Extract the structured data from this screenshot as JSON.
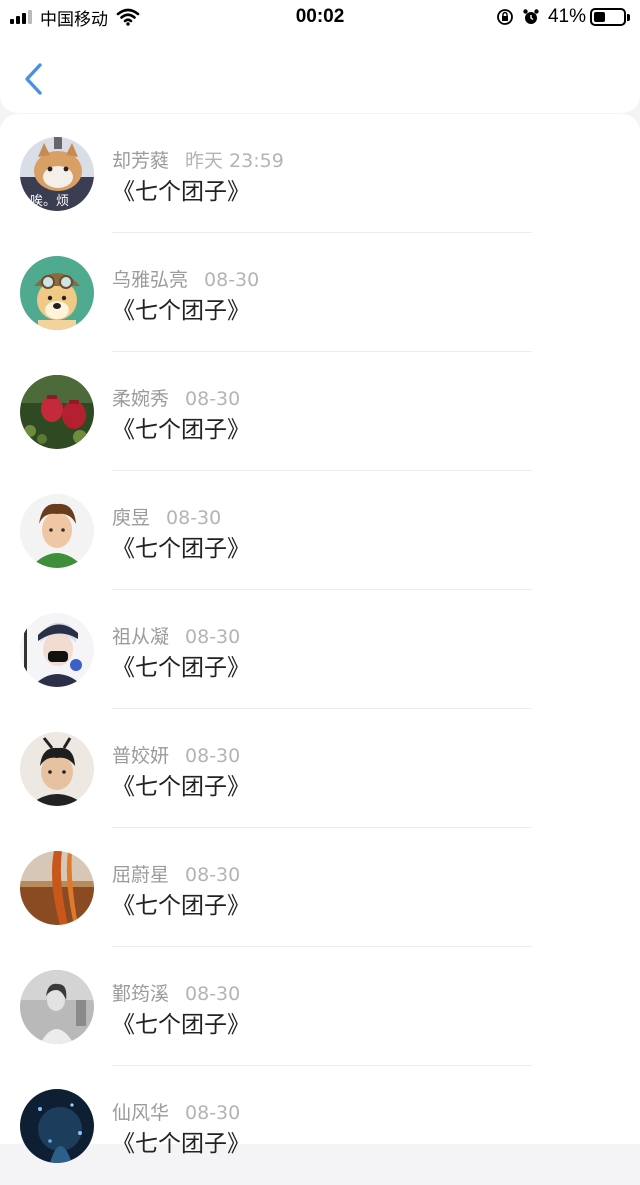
{
  "status_bar": {
    "carrier": "中国移动",
    "time": "00:02",
    "battery": "41%",
    "battery_level": 0.41
  },
  "header": {
    "back_icon": "chevron-left-icon"
  },
  "items": [
    {
      "name": "却芳蕤",
      "time": "昨天 23:59",
      "title": "《七个团子》",
      "avatar": "cat-avatar"
    },
    {
      "name": "乌雅弘亮",
      "time": "08-30",
      "title": "《七个团子》",
      "avatar": "doge-avatar"
    },
    {
      "name": "柔婉秀",
      "time": "08-30",
      "title": "《七个团子》",
      "avatar": "strawberry-avatar"
    },
    {
      "name": "庾昱",
      "time": "08-30",
      "title": "《七个团子》",
      "avatar": "boy-avatar"
    },
    {
      "name": "祖从凝",
      "time": "08-30",
      "title": "《七个团子》",
      "avatar": "anime-avatar"
    },
    {
      "name": "普姣妍",
      "time": "08-30",
      "title": "《七个团子》",
      "avatar": "man-avatar"
    },
    {
      "name": "屈蔚星",
      "time": "08-30",
      "title": "《七个团子》",
      "avatar": "sunset-avatar"
    },
    {
      "name": "鄞筠溪",
      "time": "08-30",
      "title": "《七个团子》",
      "avatar": "bw-girl-avatar"
    },
    {
      "name": "仙风华",
      "time": "08-30",
      "title": "《七个团子》",
      "avatar": "night-avatar"
    }
  ]
}
